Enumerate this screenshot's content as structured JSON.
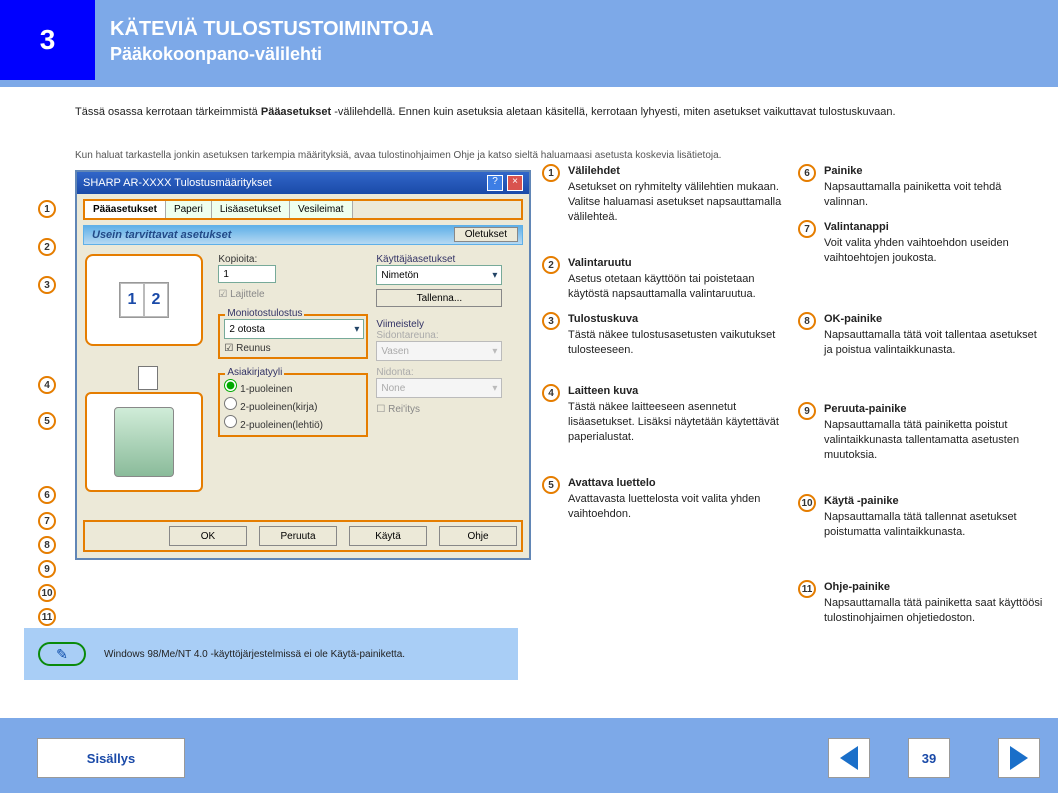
{
  "header": {
    "square": "3",
    "title": "KÄTEVIÄ TULOSTUSTOIMINTOJA",
    "sub": "Pääkokoonpano-välilehti"
  },
  "intro": {
    "text_before_link": "Tässä osassa kerrotaan tärkeimmistä ",
    "link": "Pääasetukset",
    "text_after_link": "-välilehdellä. Ennen kuin asetuksia aletaan käsitellä, kerrotaan lyhyesti, miten asetukset vaikuttavat tulostuskuvaan.",
    "note": "Kun haluat tarkastella jonkin asetuksen tarkempia määrityksiä, avaa tulostinohjaimen Ohje ja katso sieltä haluamaasi asetusta koskevia lisätietoja."
  },
  "shot": {
    "title": "SHARP AR-XXXX Tulostusmääritykset",
    "tabs": [
      "Pääasetukset",
      "Paperi",
      "Lisäasetukset",
      "Vesileimat"
    ],
    "banner": "Usein tarvittavat asetukset",
    "defaults_btn": "Oletukset",
    "copies_lbl": "Kopioita:",
    "copies_val": "1",
    "collate_lbl": "Lajittele",
    "nup_group": "Moniotostulostus",
    "nup_val": "2 otosta",
    "border_lbl": "Reunus",
    "docstyle_group": "Asiakirjatyyli",
    "doc_opt1": "1-puoleinen",
    "doc_opt2": "2-puoleinen(kirja)",
    "doc_opt3": "2-puoleinen(lehtiö)",
    "userset_group": "Käyttäjäasetukset",
    "userset_val": "Nimetön",
    "save_btn": "Tallenna...",
    "finish_group": "Viimeistely",
    "binding_lbl": "Sidontareuna:",
    "binding_val": "Vasen",
    "staple_lbl": "Nidonta:",
    "staple_val": "None",
    "punch_lbl": "Rei'itys",
    "ok": "OK",
    "cancel": "Peruuta",
    "apply": "Käytä",
    "help": "Ohje"
  },
  "left_nums": {
    "n1": "1",
    "n2": "2",
    "n3": "3",
    "n4": "4",
    "n5": "5",
    "n6": "6",
    "n7": "7",
    "n8": "8",
    "n9": "9",
    "n10": "10",
    "n11": "11"
  },
  "right": {
    "n1": {
      "num": "1",
      "title": "Välilehdet",
      "desc": "Asetukset on ryhmitelty välilehtien mukaan. Valitse haluamasi asetukset napsauttamalla välilehteä."
    },
    "n2": {
      "num": "2",
      "title": "Valintaruutu",
      "desc": "Asetus otetaan käyttöön tai poistetaan käytöstä napsauttamalla valintaruutua."
    },
    "n3": {
      "num": "3",
      "title": "Tulostuskuva",
      "desc": "Tästä näkee tulostusasetusten vaikutukset tulosteeseen."
    },
    "n4": {
      "num": "4",
      "title": "Laitteen kuva",
      "desc": "Tästä näkee laitteeseen asennetut lisäasetukset. Lisäksi näytetään käytettävät paperialustat."
    },
    "n5": {
      "num": "5",
      "title": "Avattava luettelo",
      "desc": "Avattavasta luettelosta voit valita yhden vaihtoehdon."
    },
    "n6": {
      "num": "6",
      "title": "Painike",
      "desc": "Napsauttamalla painiketta voit tehdä valinnan."
    },
    "n7": {
      "num": "7",
      "title": "Valintanappi",
      "desc": "Voit valita yhden vaihtoehdon useiden vaihtoehtojen joukosta."
    },
    "n8": {
      "num": "8",
      "title": "OK-painike",
      "desc": "Napsauttamalla tätä voit tallentaa asetukset ja poistua valintaikkunasta."
    },
    "n9": {
      "num": "9",
      "title": "Peruuta-painike",
      "desc": "Napsauttamalla tätä painiketta poistut valintaikkunasta tallentamatta asetusten muutoksia."
    },
    "n10": {
      "num": "10",
      "title": "Käytä -painike",
      "desc": "Napsauttamalla tätä tallennat asetukset poistumatta valintaikkunasta."
    },
    "n11": {
      "num": "11",
      "title": "Ohje-painike",
      "desc": "Napsauttamalla tätä painiketta saat käyttöösi tulostinohjaimen ohjetiedoston."
    }
  },
  "note": {
    "text": "Windows 98/Me/NT 4.0 -käyttöjärjestelmissä ei ole Käytä-painiketta."
  },
  "footer": {
    "contents": "Sisällys",
    "page": "39"
  }
}
